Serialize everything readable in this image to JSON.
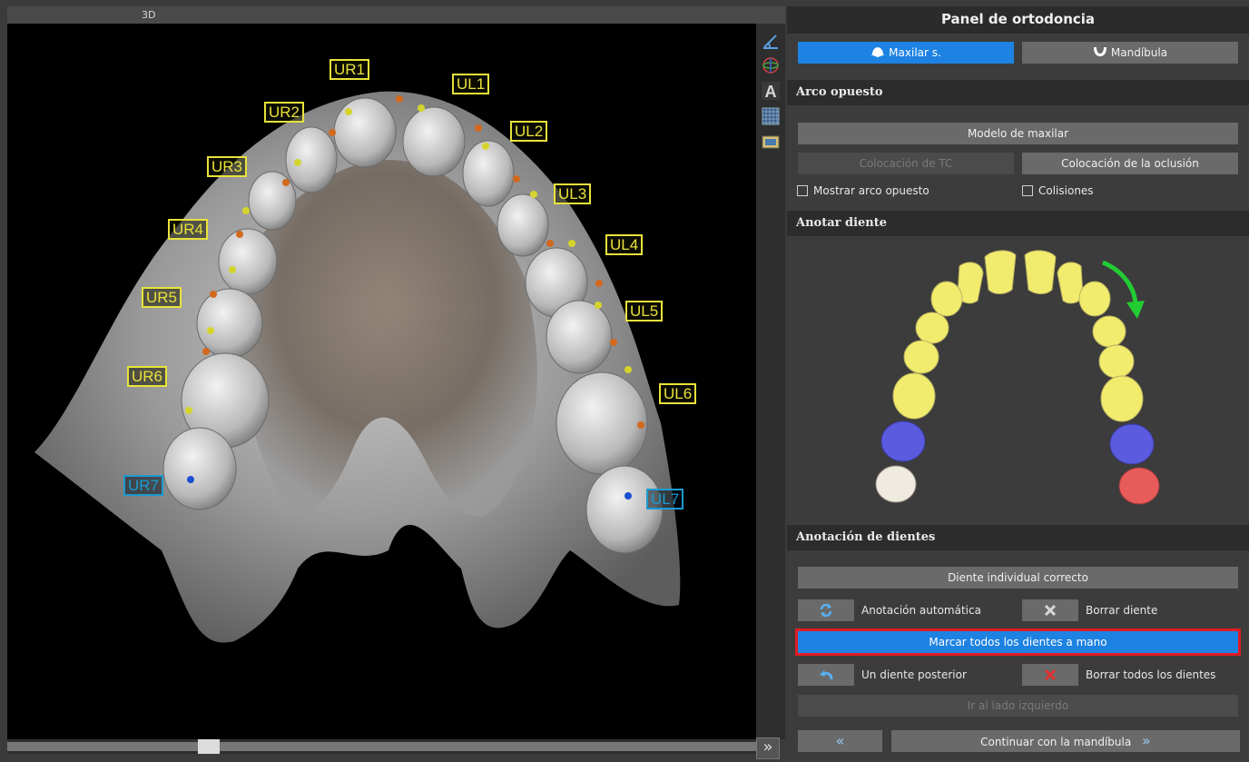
{
  "viewport": {
    "title": "3D",
    "tooth_labels": [
      {
        "id": "UR1",
        "color": "#e8e23a"
      },
      {
        "id": "UL1",
        "color": "#e8e23a"
      },
      {
        "id": "UR2",
        "color": "#e8e23a"
      },
      {
        "id": "UL2",
        "color": "#e8e23a"
      },
      {
        "id": "UR3",
        "color": "#e8e23a"
      },
      {
        "id": "UL3",
        "color": "#e8e23a"
      },
      {
        "id": "UR4",
        "color": "#e8e23a"
      },
      {
        "id": "UL4",
        "color": "#e8e23a"
      },
      {
        "id": "UR5",
        "color": "#e8e23a"
      },
      {
        "id": "UL5",
        "color": "#e8e23a"
      },
      {
        "id": "UR6",
        "color": "#e8e23a"
      },
      {
        "id": "UL6",
        "color": "#e8e23a"
      },
      {
        "id": "UR7",
        "color": "#1b9bd1"
      },
      {
        "id": "UL7",
        "color": "#1b9bd1"
      }
    ],
    "toolbar_icons": [
      "measure-icon",
      "orientation-icon",
      "annotation-text-icon",
      "grid-icon",
      "screenshot-icon"
    ],
    "expand_glyph": "»"
  },
  "panel": {
    "title": "Panel de ortodoncia",
    "jaw_tabs": [
      {
        "label": "Maxilar s.",
        "icon": "upper-jaw-icon",
        "active": true
      },
      {
        "label": "Mandíbula",
        "icon": "lower-jaw-icon",
        "active": false
      }
    ],
    "opposite_arch": {
      "header": "Arco opuesto",
      "model_button": "Modelo de maxilar",
      "ct_button": "Colocación de TC",
      "occlusion_button": "Colocación de la oclusión",
      "show_opposite": "Mostrar arco opuesto",
      "collisions": "Colisiones"
    },
    "annotate_tooth": {
      "header": "Anotar diente"
    },
    "tooth_annotation": {
      "header": "Anotación de dientes",
      "correct_button": "Diente individual correcto",
      "auto_label": "Anotación automática",
      "delete_label": "Borrar diente",
      "mark_all_button": "Marcar todos los dientes a mano",
      "previous_label": "Un diente posterior",
      "delete_all_label": "Borrar todos los dientes",
      "left_side_button": "Ir al lado izquierdo"
    },
    "footer": {
      "back_glyph": "«",
      "continue_label": "Continuar con la mandíbula",
      "continue_glyph": "»"
    }
  },
  "colors": {
    "accent_blue": "#1d82e2",
    "highlight_red": "#e01b24",
    "tooth_yellow": "#f2ec6e",
    "tooth_purple": "#5b5be0",
    "tooth_red": "#e85b5b",
    "tooth_white": "#efebe0",
    "arrow_green": "#22cc33"
  }
}
